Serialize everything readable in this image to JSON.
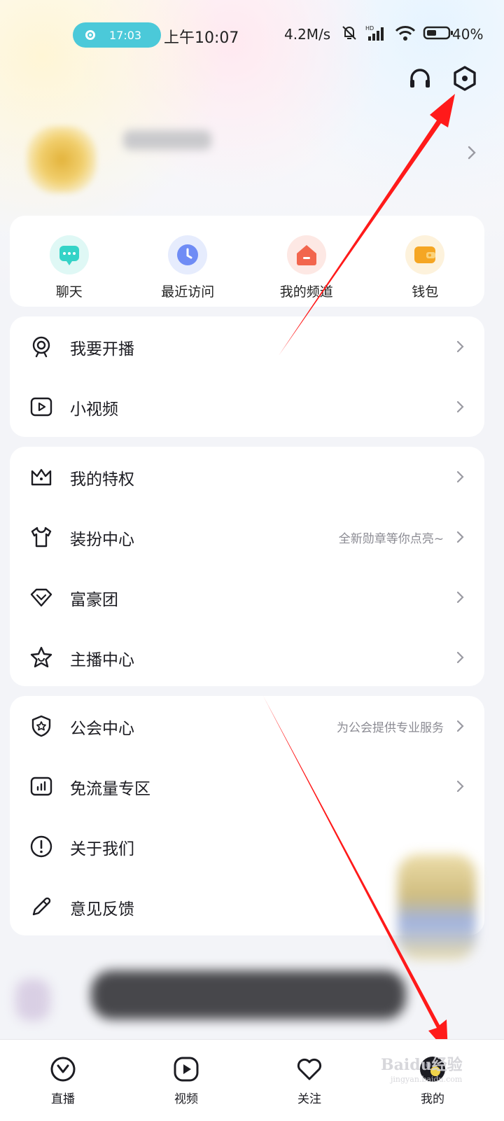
{
  "status_bar": {
    "call_time": "17:03",
    "clock": "上午10:07",
    "speed": "4.2M/s",
    "network": "HD",
    "battery": "40%"
  },
  "header": {
    "icons": [
      "headphones-icon",
      "settings-icon"
    ]
  },
  "quick_actions": [
    {
      "label": "聊天",
      "icon": "chat-icon",
      "color": "#35d3c7"
    },
    {
      "label": "最近访问",
      "icon": "clock-icon",
      "color": "#6f8cf5"
    },
    {
      "label": "我的频道",
      "icon": "home-icon",
      "color": "#f2654d"
    },
    {
      "label": "钱包",
      "icon": "wallet-icon",
      "color": "#f5a623"
    }
  ],
  "menu_group_1": [
    {
      "label": "我要开播",
      "icon": "camera-icon"
    },
    {
      "label": "小视频",
      "icon": "video-icon"
    }
  ],
  "menu_group_2": [
    {
      "label": "我的特权",
      "icon": "crown-icon"
    },
    {
      "label": "装扮中心",
      "icon": "shirt-icon",
      "hint": "全新勋章等你点亮~"
    },
    {
      "label": "富豪团",
      "icon": "diamond-icon"
    },
    {
      "label": "主播中心",
      "icon": "star-icon"
    }
  ],
  "menu_group_3": [
    {
      "label": "公会中心",
      "icon": "shield-star-icon",
      "hint": "为公会提供专业服务"
    },
    {
      "label": "免流量专区",
      "icon": "data-chart-icon"
    },
    {
      "label": "关于我们",
      "icon": "info-icon"
    },
    {
      "label": "意见反馈",
      "icon": "pen-icon"
    }
  ],
  "bottom_nav": [
    {
      "label": "直播",
      "icon": "live-icon"
    },
    {
      "label": "视频",
      "icon": "play-icon"
    },
    {
      "label": "关注",
      "icon": "heart-icon"
    },
    {
      "label": "我的",
      "icon": "profile-avatar-icon"
    }
  ],
  "watermark": {
    "main": "Baidu经验",
    "sub": "jingyan.baidu.com"
  },
  "colors": {
    "annotation_arrow": "#ff1a1a",
    "text": "#1c1c22",
    "hint": "#8b8b93",
    "card": "#ffffff"
  }
}
